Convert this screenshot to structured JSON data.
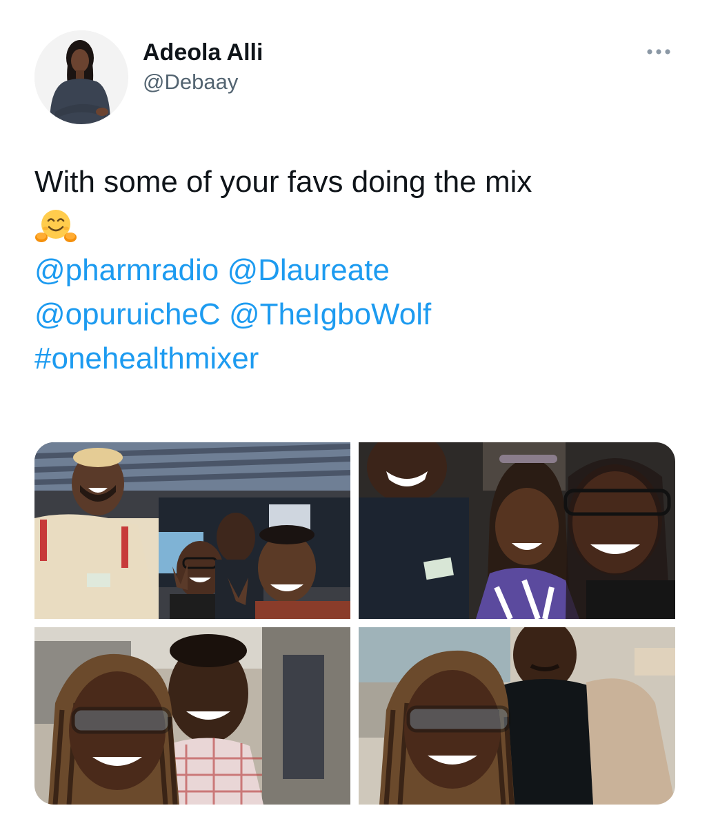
{
  "author": {
    "display_name": "Adeola Alli",
    "handle": "@Debaay",
    "avatar_icon": "profile-photo"
  },
  "more_icon": "ellipsis-icon",
  "tweet": {
    "text_line_1": "With some of your favs doing the mix",
    "emoji": "smiling-face-with-open-hands",
    "mentions": [
      "@pharmradio",
      "@Dlaureate",
      "@opuruicheC",
      "@TheIgboWolf"
    ],
    "hashtag": "#onehealthmixer"
  },
  "media": {
    "photo_count": 4,
    "photos": [
      {
        "description_icon": "group-selfie-photo"
      },
      {
        "description_icon": "group-selfie-photo"
      },
      {
        "description_icon": "duo-selfie-photo"
      },
      {
        "description_icon": "duo-selfie-photo"
      }
    ]
  },
  "colors": {
    "link": "#1d9bf0",
    "text": "#0f1419",
    "secondary": "#536471"
  }
}
